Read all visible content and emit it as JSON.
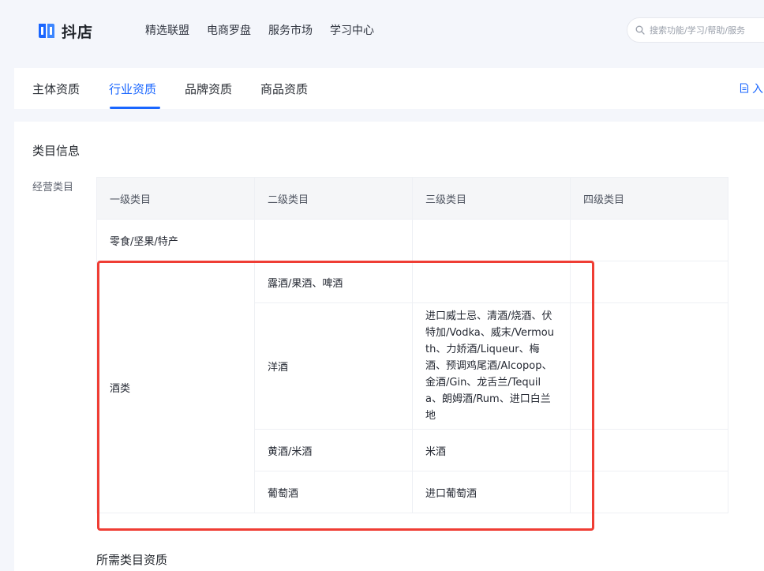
{
  "brand": {
    "name": "抖店",
    "accent": "#1966ff"
  },
  "nav": {
    "items": [
      "精选联盟",
      "电商罗盘",
      "服务市场",
      "学习中心"
    ]
  },
  "search": {
    "placeholder": "搜索功能/学习/帮助/服务"
  },
  "tabs": {
    "items": [
      "主体资质",
      "行业资质",
      "品牌资质",
      "商品资质"
    ],
    "active": "行业资质",
    "right_label": "入"
  },
  "section": {
    "title": "类目信息",
    "field_label": "经营类目",
    "bottom_title": "所需类目资质"
  },
  "table": {
    "headers": [
      "一级类目",
      "二级类目",
      "三级类目",
      "四级类目"
    ],
    "row1": {
      "l1": "零食/坚果/特产",
      "l2": "",
      "l3": "",
      "l4": ""
    },
    "group": {
      "l1": "酒类",
      "rows": [
        {
          "l2": "露酒/果酒、啤酒",
          "l3": "",
          "l4": ""
        },
        {
          "l2": "洋酒",
          "l3": "进口威士忌、清酒/烧酒、伏特加/Vodka、威末/Vermouth、力娇酒/Liqueur、梅酒、预调鸡尾酒/Alcopop、金酒/Gin、龙舌兰/Tequila、朗姆酒/Rum、进口白兰地",
          "l4": ""
        },
        {
          "l2": "黄酒/米酒",
          "l3": "米酒",
          "l4": ""
        },
        {
          "l2": "葡萄酒",
          "l3": "进口葡萄酒",
          "l4": ""
        }
      ]
    }
  },
  "colors": {
    "highlight": "#ef3d34",
    "page_bg": "#f4f6fb"
  }
}
